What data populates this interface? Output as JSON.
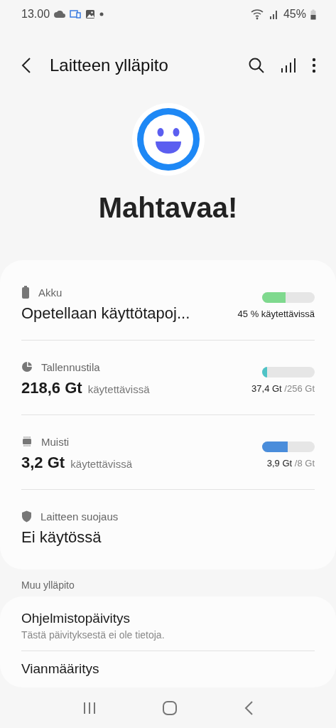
{
  "status_bar": {
    "time": "13.00",
    "battery": "45%"
  },
  "header": {
    "title": "Laitteen ylläpito"
  },
  "status": {
    "text": "Mahtavaa!"
  },
  "items": [
    {
      "kind": "battery",
      "label": "Akku",
      "main": "Opetellaan käyttötapoj...",
      "level": 0.45,
      "color": "#7fd98e",
      "reading": "45 % käytettävissä"
    },
    {
      "kind": "storage",
      "label": "Tallennustila",
      "main": "218,6 Gt",
      "suffix": "käytettävissä",
      "level": 0.1,
      "color": "#4fc3c6",
      "used": "37,4 Gt",
      "total": "/256 Gt"
    },
    {
      "kind": "memory",
      "label": "Muisti",
      "main": "3,2 Gt",
      "suffix": "käytettävissä",
      "level": 0.49,
      "color": "#4a8ddb",
      "used": "3,9 Gt",
      "total": "/8 Gt"
    },
    {
      "kind": "security",
      "label": "Laitteen suojaus",
      "main": "Ei käytössä"
    }
  ],
  "other": {
    "heading": "Muu ylläpito",
    "items": [
      {
        "title": "Ohjelmistopäivitys",
        "subtitle": "Tästä päivityksestä ei ole tietoja."
      },
      {
        "title": "Vianmääritys"
      }
    ]
  }
}
